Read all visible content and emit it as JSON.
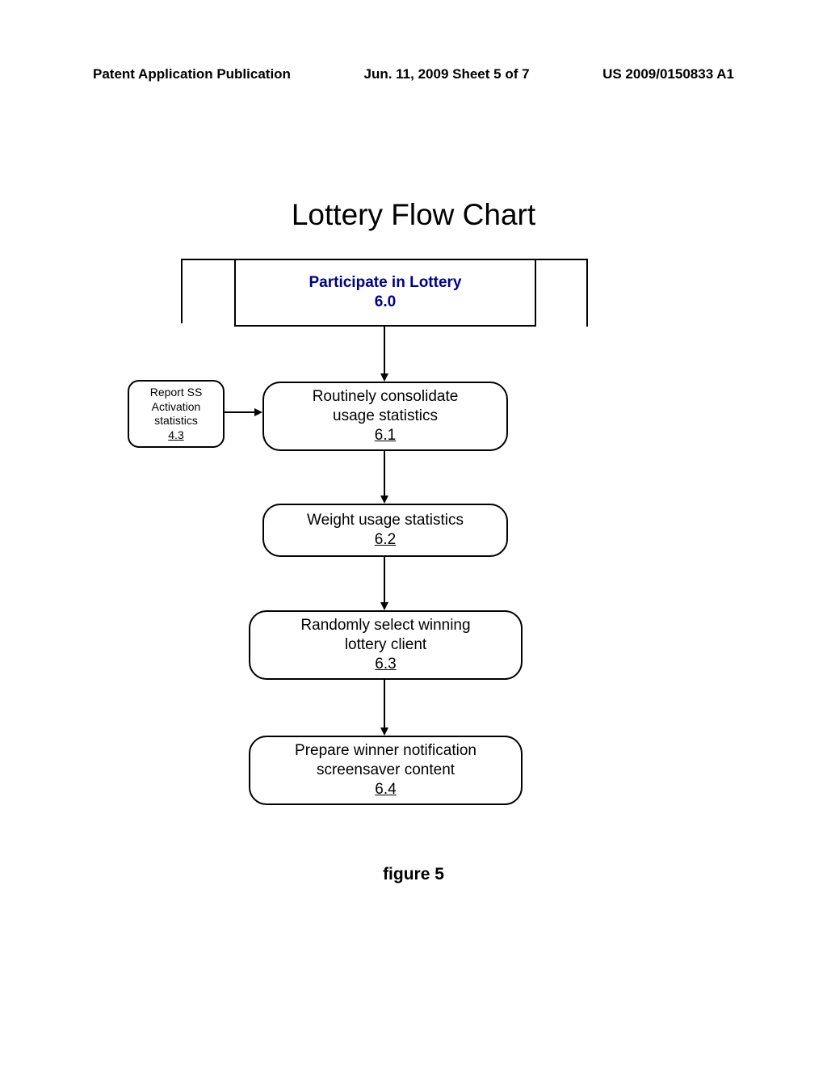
{
  "header": {
    "left": "Patent Application Publication",
    "center": "Jun. 11, 2009  Sheet 5 of 7",
    "right": "US 2009/0150833 A1"
  },
  "title": "Lottery Flow Chart",
  "boxes": {
    "participate": {
      "line1": "Participate in Lottery",
      "num": "6.0"
    },
    "report": {
      "line1": "Report SS",
      "line2": "Activation",
      "line3": "statistics",
      "num": "4.3"
    },
    "consolidate": {
      "line1": "Routinely consolidate",
      "line2": "usage statistics",
      "num": "6.1"
    },
    "weight": {
      "line1": "Weight  usage statistics",
      "num": "6.2"
    },
    "select": {
      "line1": "Randomly select winning",
      "line2": "lottery client",
      "num": "6.3"
    },
    "prepare": {
      "line1": "Prepare winner notification",
      "line2": "screensaver content",
      "num": "6.4"
    }
  },
  "figure_label": "figure 5"
}
